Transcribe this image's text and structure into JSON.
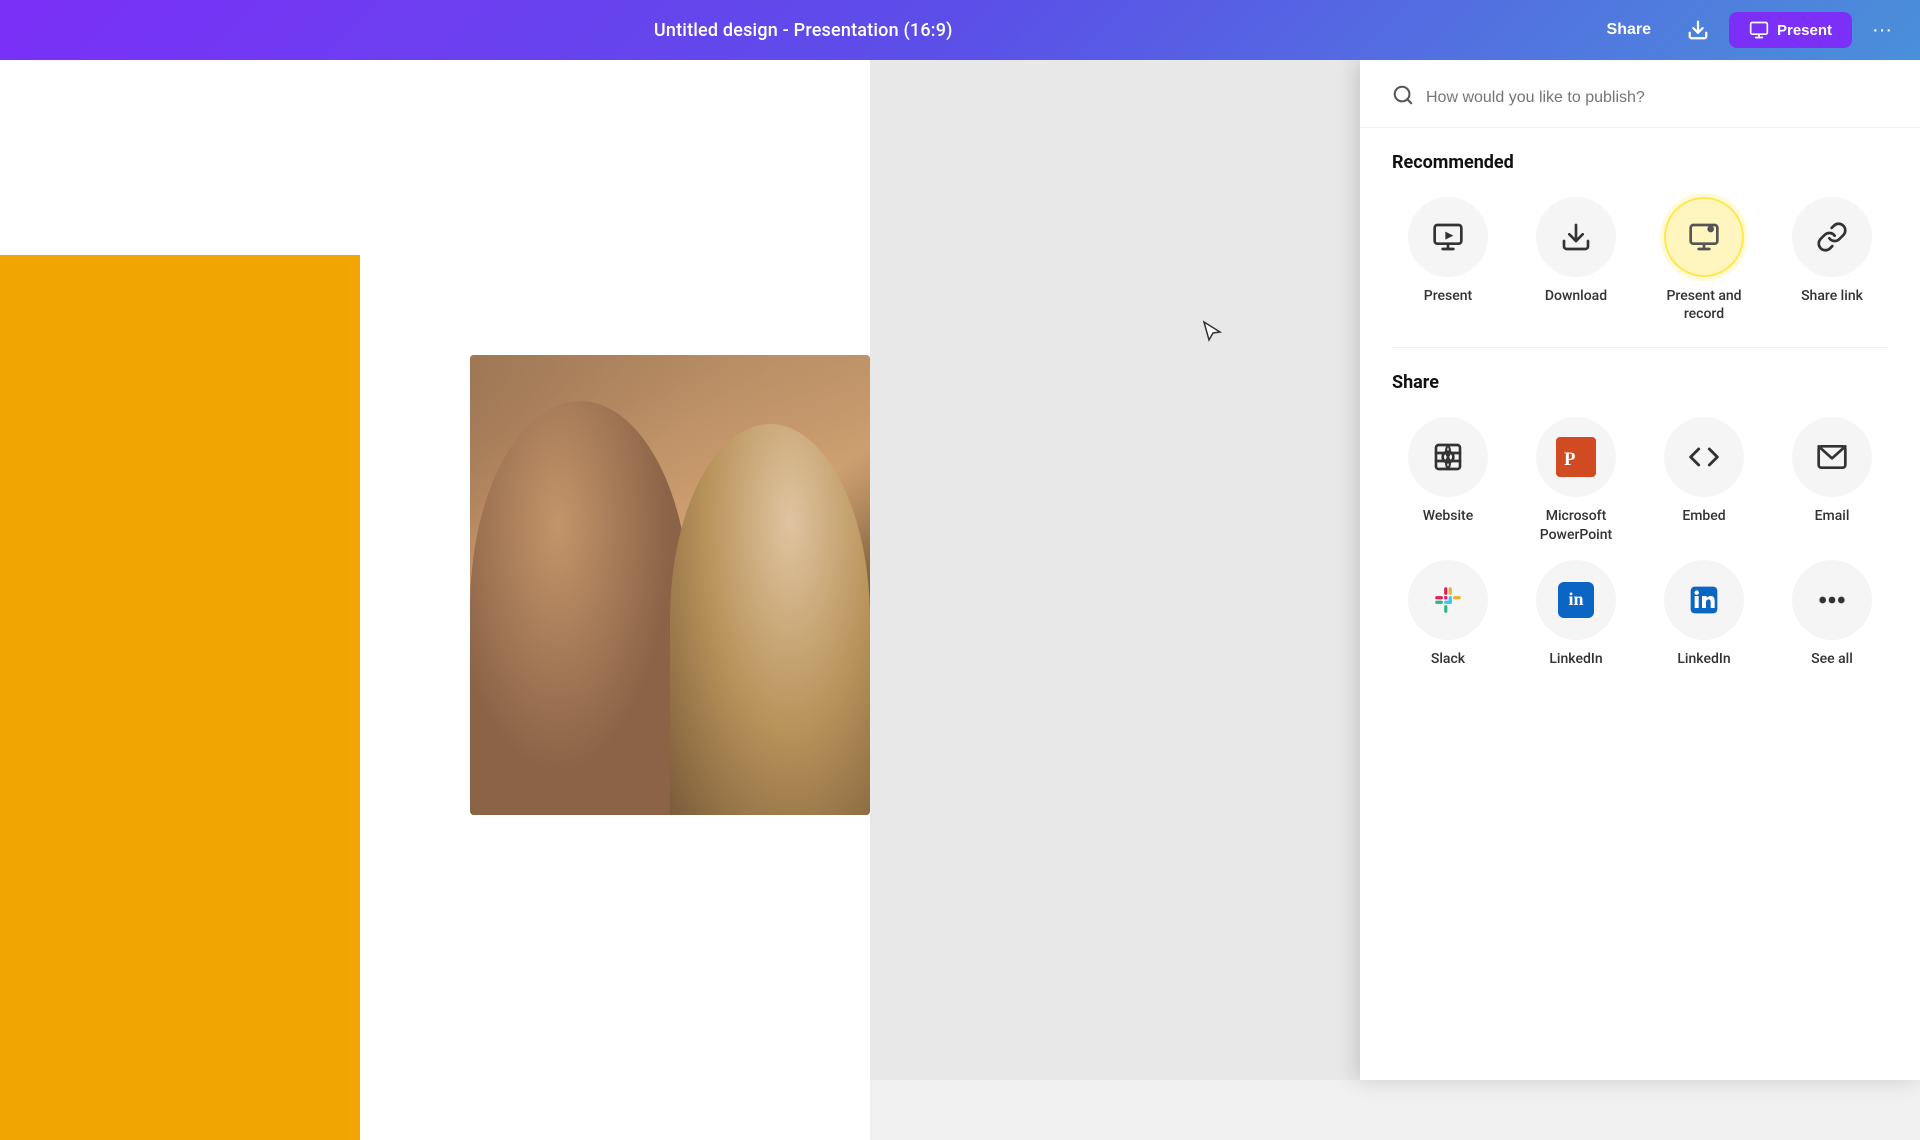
{
  "header": {
    "title": "Untitled design - Presentation (16:9)",
    "share_label": "Share",
    "present_label": "Present",
    "more_label": "···"
  },
  "search": {
    "placeholder": "How would you like to publish?"
  },
  "recommended": {
    "section_label": "Recommended",
    "items": [
      {
        "id": "present",
        "label": "Present",
        "icon": "present-icon"
      },
      {
        "id": "download",
        "label": "Download",
        "icon": "download-icon"
      },
      {
        "id": "present-record",
        "label": "Present and record",
        "icon": "present-record-icon"
      },
      {
        "id": "share-link",
        "label": "Share link",
        "icon": "share-link-icon"
      }
    ]
  },
  "share": {
    "section_label": "Share",
    "items": [
      {
        "id": "website",
        "label": "Website",
        "icon": "website-icon"
      },
      {
        "id": "ms-powerpoint",
        "label": "Microsoft PowerPoint",
        "icon": "powerpoint-icon"
      },
      {
        "id": "embed",
        "label": "Embed",
        "icon": "embed-icon"
      },
      {
        "id": "email",
        "label": "Email",
        "icon": "email-icon"
      },
      {
        "id": "slack",
        "label": "Slack",
        "icon": "slack-icon"
      },
      {
        "id": "linkedin",
        "label": "LinkedIn",
        "icon": "linkedin-icon"
      },
      {
        "id": "linkedin2",
        "label": "LinkedIn",
        "icon": "linkedin2-icon"
      },
      {
        "id": "see-all",
        "label": "See all",
        "icon": "more-icon"
      }
    ]
  },
  "colors": {
    "header_gradient_start": "#7B2FF7",
    "header_gradient_end": "#4A90D9",
    "yellow_block": "#F0A500",
    "highlight_ring": "rgba(255,220,0,0.4)"
  }
}
